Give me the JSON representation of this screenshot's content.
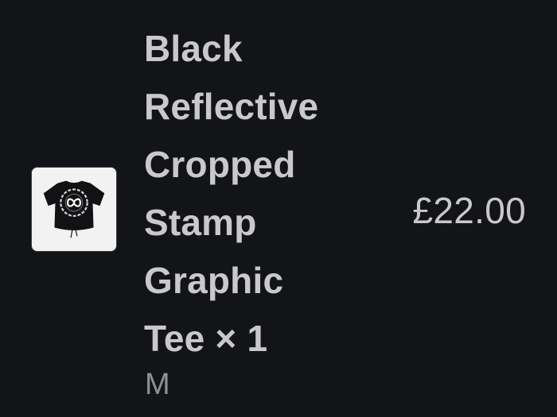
{
  "cart_item": {
    "image_icon": "black-cropped-tee-product-image",
    "name": "Black\nReflective\nCropped\nStamp\nGraphic\nTee × 1",
    "variant": "M",
    "price": "£22.00"
  },
  "colors": {
    "background": "#131418",
    "primary_text": "#c9c9cc",
    "secondary_text": "#8f9096",
    "thumbnail_background": "#f2f2f3"
  }
}
